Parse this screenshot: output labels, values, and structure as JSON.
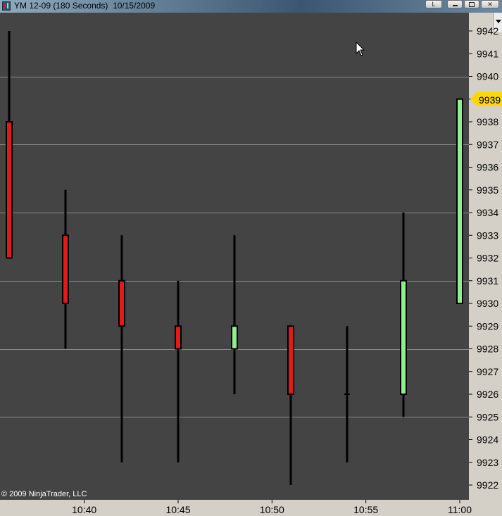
{
  "window": {
    "title": "YM 12-09 (180 Seconds)  10/15/2009",
    "btn_link": "L"
  },
  "copyright": "© 2009 NinjaTrader, LLC",
  "last_price_label": "9939",
  "colors": {
    "background": "#444444",
    "up_candle": "#90ee90",
    "down_candle": "#e21a1a",
    "wick": "#000000",
    "gridline": "#8a8a8a",
    "price_marker": "#ffd700"
  },
  "chart_data": {
    "type": "candlestick",
    "interval": "180 Seconds",
    "date": "10/15/2009",
    "x_ticks": [
      "10:40",
      "10:45",
      "10:50",
      "10:55",
      "11:00"
    ],
    "y_ticks": [
      9922,
      9923,
      9924,
      9925,
      9926,
      9927,
      9928,
      9929,
      9930,
      9931,
      9932,
      9933,
      9934,
      9935,
      9936,
      9937,
      9938,
      9939,
      9940,
      9941,
      9942
    ],
    "ylim": [
      9922,
      9942
    ],
    "grid_lines": [
      9925,
      9928,
      9931,
      9934,
      9937,
      9940
    ],
    "last_price": 9939,
    "candles": [
      {
        "time": "10:36",
        "open": 9938,
        "high": 9942,
        "low": 9932,
        "close": 9932
      },
      {
        "time": "10:39",
        "open": 9933,
        "high": 9935,
        "low": 9928,
        "close": 9930
      },
      {
        "time": "10:42",
        "open": 9931,
        "high": 9933,
        "low": 9923,
        "close": 9929
      },
      {
        "time": "10:45",
        "open": 9929,
        "high": 9931,
        "low": 9923,
        "close": 9928
      },
      {
        "time": "10:48",
        "open": 9928,
        "high": 9933,
        "low": 9926,
        "close": 9929
      },
      {
        "time": "10:51",
        "open": 9929,
        "high": 9929,
        "low": 9922,
        "close": 9926
      },
      {
        "time": "10:54",
        "open": 9926,
        "high": 9929,
        "low": 9923,
        "close": 9926
      },
      {
        "time": "10:57",
        "open": 9926,
        "high": 9934,
        "low": 9925,
        "close": 9931
      },
      {
        "time": "11:00",
        "open": 9930,
        "high": 9939,
        "low": 9930,
        "close": 9939
      }
    ]
  }
}
